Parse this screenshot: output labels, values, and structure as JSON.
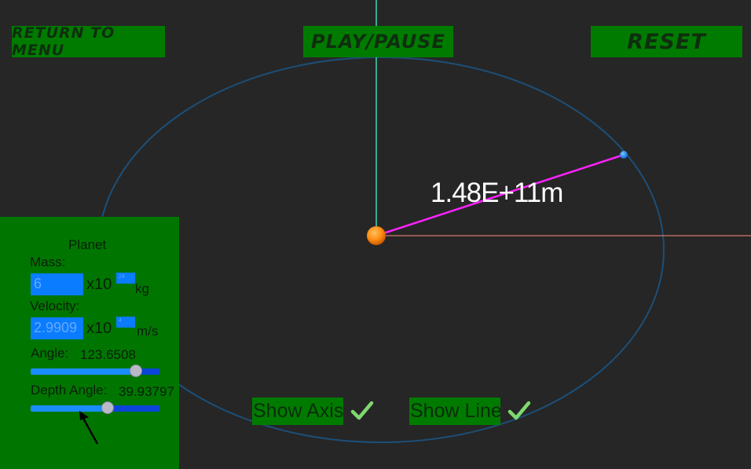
{
  "buttons": {
    "return_label": "Return to Menu",
    "play_label": "Play/Pause",
    "reset_label": "Reset"
  },
  "distance_label": "1.48E+11m",
  "panel": {
    "title": "Planet",
    "mass": {
      "label": "Mass:",
      "value": "6",
      "multiplier": "x10",
      "exponent": "24",
      "unit": "kg"
    },
    "velocity": {
      "label": "Velocity:",
      "value": "2.9909",
      "multiplier": "x10",
      "exponent": "4",
      "unit": "m/s"
    },
    "angle": {
      "label": "Angle:",
      "value": "123.6508",
      "slider_fraction": 0.82
    },
    "depth_angle": {
      "label": "Depth Angle:",
      "value": "39.93797",
      "slider_fraction": 0.6
    }
  },
  "toggles": {
    "show_axis": {
      "label": "Show Axis",
      "checked": true
    },
    "show_line": {
      "label": "Show Line",
      "checked": true
    }
  },
  "colors": {
    "background": "#262626",
    "orbit": "#1c4f78",
    "y_axis": "#3dd9b0",
    "x_axis": "#ff8a7a",
    "radius_line": "#ff22ff",
    "star": "#ff8c10",
    "planet": "#1e8cff",
    "panel": "#007600",
    "checkmark": "#7fd86f"
  }
}
